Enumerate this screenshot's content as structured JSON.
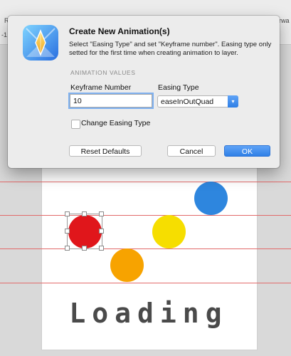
{
  "background": {
    "ruler_labels": [
      "R",
      "-1",
      "rwa"
    ],
    "loading_text": "Loading",
    "balls": [
      {
        "name": "blue-ball",
        "color": "#2e86de"
      },
      {
        "name": "red-ball",
        "color": "#e0161b"
      },
      {
        "name": "yellow-ball",
        "color": "#f6de00"
      },
      {
        "name": "orange-ball",
        "color": "#f7a300"
      }
    ],
    "guide_color": "#e26a6a"
  },
  "dialog": {
    "icon": "app-crystal-icon",
    "title": "Create New Animation(s)",
    "description": "Select \"Easing Type\" and set \"Keyframe number\". Easing type only setted for the first time when creating animation to layer.",
    "section_label": "ANIMATION VALUES",
    "keyframe_label": "Keyframe Number",
    "keyframe_value": "10",
    "easing_label": "Easing Type",
    "easing_value": "easeInOutQuad",
    "change_easing_label": "Change Easing Type",
    "change_easing_checked": false,
    "reset_button": "Reset Defaults",
    "cancel_button": "Cancel",
    "ok_button": "OK",
    "accent_color": "#2f7fe6"
  }
}
